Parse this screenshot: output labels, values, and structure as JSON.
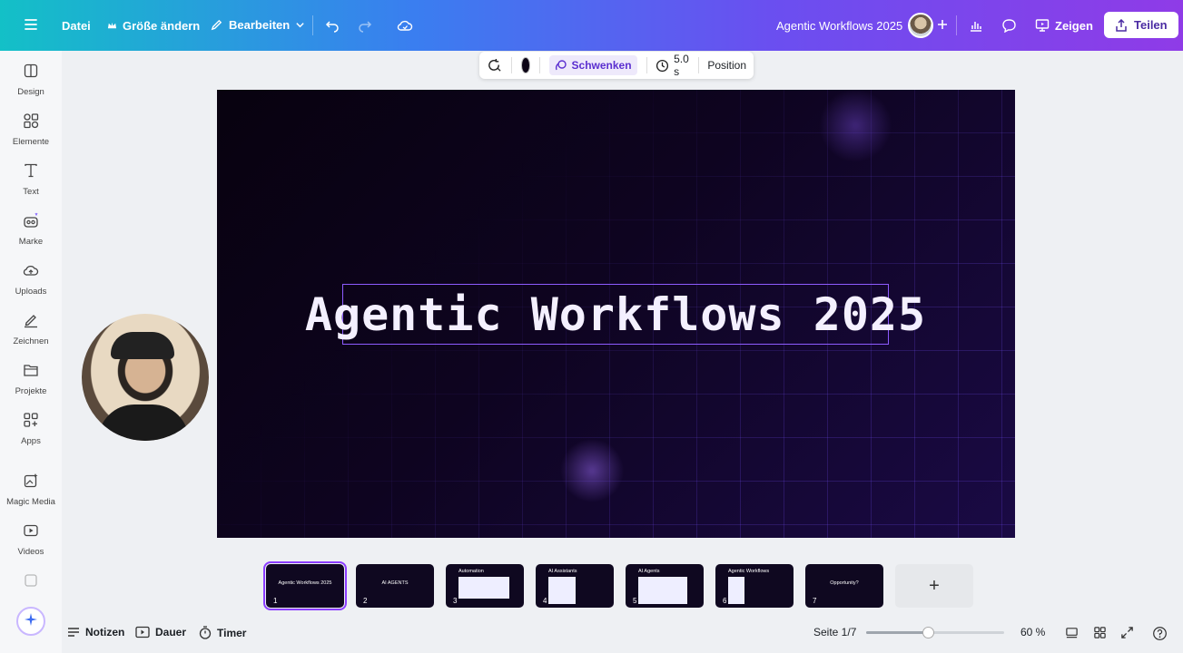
{
  "topbar": {
    "menu_icon": "hamburger-icon",
    "file_label": "Datei",
    "resize_label": "Größe ändern",
    "edit_label": "Bearbeiten",
    "project_title": "Agentic Workflows 2025",
    "present_label": "Zeigen",
    "share_label": "Teilen"
  },
  "sidebar": {
    "items": [
      {
        "label": "Design",
        "icon": "layout-icon"
      },
      {
        "label": "Elemente",
        "icon": "shapes-icon"
      },
      {
        "label": "Text",
        "icon": "text-icon"
      },
      {
        "label": "Marke",
        "icon": "brand-icon"
      },
      {
        "label": "Uploads",
        "icon": "upload-cloud-icon"
      },
      {
        "label": "Zeichnen",
        "icon": "draw-icon"
      },
      {
        "label": "Projekte",
        "icon": "folder-icon"
      },
      {
        "label": "Apps",
        "icon": "apps-icon"
      },
      {
        "label": "Magic Media",
        "icon": "magic-media-icon"
      },
      {
        "label": "Videos",
        "icon": "video-icon"
      }
    ]
  },
  "context_toolbar": {
    "animation_label": "Schwenken",
    "duration_label": "5.0 s",
    "position_label": "Position",
    "color": "#0d0616"
  },
  "slide": {
    "title": "Agentic Workflows 2025"
  },
  "thumbnails": [
    {
      "num": "1",
      "title": "Agentic Workflows 2025"
    },
    {
      "num": "2",
      "title": "AI AGENTS"
    },
    {
      "num": "3",
      "title": "Automation"
    },
    {
      "num": "4",
      "title": "AI Assistants"
    },
    {
      "num": "5",
      "title": "AI Agents"
    },
    {
      "num": "6",
      "title": "Agentic Workflows"
    },
    {
      "num": "7",
      "title": "Opportunity?"
    }
  ],
  "bottombar": {
    "notes_label": "Notizen",
    "duration_label": "Dauer",
    "timer_label": "Timer",
    "page_label": "Seite 1/7",
    "zoom_label": "60 %",
    "zoom_value": 0.45
  },
  "colors": {
    "accent": "#8b3dff"
  }
}
